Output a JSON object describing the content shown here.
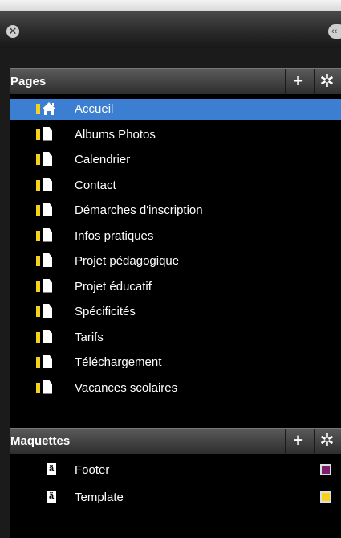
{
  "window": {
    "close_glyph": "✕",
    "collapse_glyph": "‹‹"
  },
  "pages": {
    "title": "Pages",
    "add_glyph": "+",
    "settings_glyph": "✲",
    "items": [
      {
        "label": "Accueil",
        "icon": "home-icon",
        "selected": true
      },
      {
        "label": "Albums Photos",
        "icon": "page-icon"
      },
      {
        "label": "Calendrier",
        "icon": "page-icon"
      },
      {
        "label": "Contact",
        "icon": "page-icon"
      },
      {
        "label": "Démarches d'inscription",
        "icon": "page-icon"
      },
      {
        "label": "Infos pratiques",
        "icon": "page-icon"
      },
      {
        "label": "Projet pédagogique",
        "icon": "page-icon"
      },
      {
        "label": "Projet éducatif",
        "icon": "page-icon"
      },
      {
        "label": "Spécificités",
        "icon": "page-icon"
      },
      {
        "label": "Tarifs",
        "icon": "page-icon"
      },
      {
        "label": "Téléchargement",
        "icon": "page-icon"
      },
      {
        "label": "Vacances scolaires",
        "icon": "page-icon"
      }
    ],
    "status_color": "#f5d31c"
  },
  "maquettes": {
    "title": "Maquettes",
    "add_glyph": "+",
    "settings_glyph": "✲",
    "icon_glyph": "ã",
    "items": [
      {
        "label": "Footer",
        "color": "#7a1f6e"
      },
      {
        "label": "Template",
        "color": "#f5d31c"
      }
    ]
  },
  "colors": {
    "selection": "#3b7ed2",
    "background": "#000000"
  }
}
